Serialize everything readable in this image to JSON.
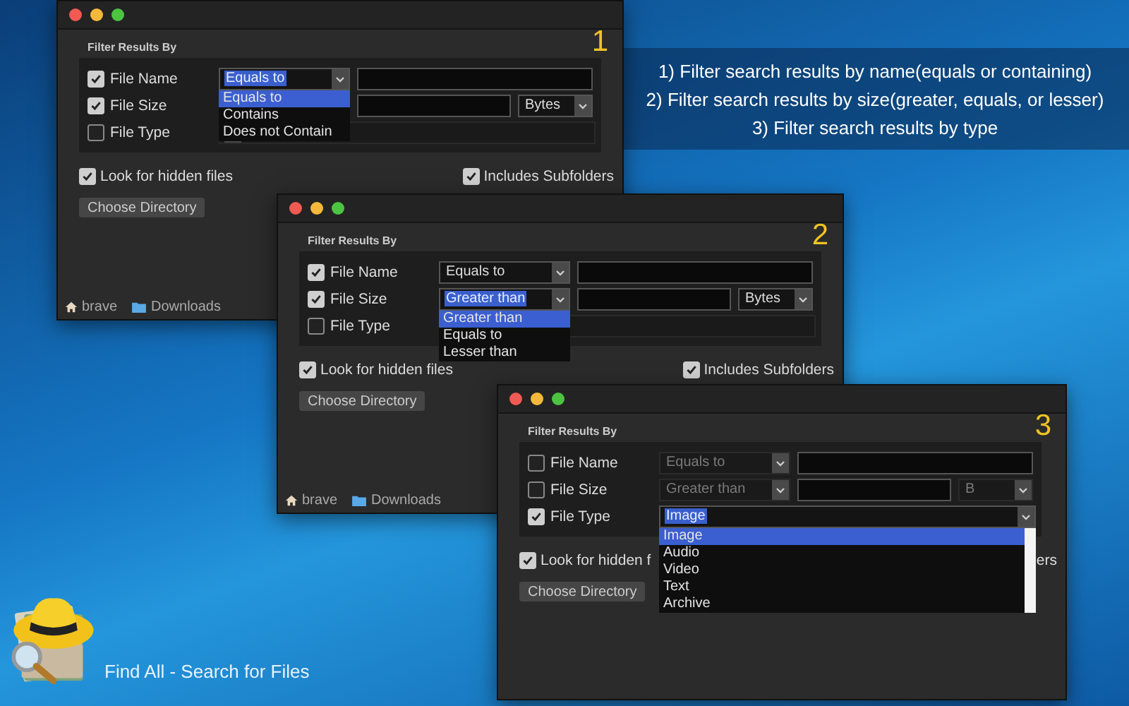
{
  "caption_lines": [
    "1) Filter search results by name(equals or containing)",
    "2) Filter search results by size(greater, equals, or lesser)",
    "3) Filter search results by type"
  ],
  "app_name": "Find All - Search for Files",
  "windows": [
    {
      "number": "1",
      "filter_title": "Filter Results By",
      "rows": [
        {
          "kind": "name",
          "label": "File Name",
          "checked": true,
          "select": {
            "value": "Equals to",
            "options": [
              {
                "label": "Equals to",
                "selected": true
              },
              {
                "label": "Contains",
                "selected": false
              },
              {
                "label": "Does not Contain",
                "selected": false
              }
            ]
          }
        },
        {
          "kind": "size",
          "label": "File Size",
          "checked": true,
          "select": {},
          "unit": "Bytes"
        },
        {
          "kind": "type",
          "label": "File Type",
          "checked": false,
          "select": {}
        }
      ],
      "hidden_files": {
        "label": "Look for hidden files",
        "checked": true
      },
      "subfolders": {
        "label": "Includes Subfolders",
        "checked": true
      },
      "choose_button": "Choose Directory",
      "path": [
        {
          "kind": "home",
          "label": "brave"
        },
        {
          "kind": "folder",
          "label": "Downloads"
        }
      ]
    },
    {
      "number": "2",
      "filter_title": "Filter Results By",
      "rows": [
        {
          "kind": "name",
          "label": "File Name",
          "checked": true,
          "select": {
            "value": "Equals to"
          }
        },
        {
          "kind": "size",
          "label": "File Size",
          "checked": true,
          "select": {
            "value": "Greater than",
            "options": [
              {
                "label": "Greater than",
                "selected": true
              },
              {
                "label": "Equals to",
                "selected": false
              },
              {
                "label": "Lesser than",
                "selected": false
              }
            ]
          },
          "unit": "Bytes"
        },
        {
          "kind": "type",
          "label": "File Type",
          "checked": false,
          "select": {}
        }
      ],
      "hidden_files": {
        "label": "Look for hidden files",
        "checked": true
      },
      "subfolders": {
        "label": "Includes Subfolders",
        "checked": true
      },
      "choose_button": "Choose Directory",
      "path": [
        {
          "kind": "home",
          "label": "brave"
        },
        {
          "kind": "folder",
          "label": "Downloads"
        }
      ]
    },
    {
      "number": "3",
      "filter_title": "Filter Results By",
      "rows": [
        {
          "kind": "name",
          "label": "File Name",
          "checked": false,
          "select": {
            "value": "Equals to"
          }
        },
        {
          "kind": "size",
          "label": "File Size",
          "checked": false,
          "select": {
            "value": "Greater than"
          },
          "unit": "B"
        },
        {
          "kind": "type",
          "label": "File Type",
          "checked": true,
          "select": {
            "value": "Image",
            "options": [
              {
                "label": "Image",
                "selected": true
              },
              {
                "label": "Audio",
                "selected": false
              },
              {
                "label": "Video",
                "selected": false
              },
              {
                "label": "Text",
                "selected": false
              },
              {
                "label": "Archive",
                "selected": false
              }
            ]
          }
        }
      ],
      "hidden_files": {
        "label": "Look for hidden f",
        "checked": true
      },
      "subfolders": {
        "label": "ers"
      },
      "choose_button": "Choose Directory"
    }
  ]
}
